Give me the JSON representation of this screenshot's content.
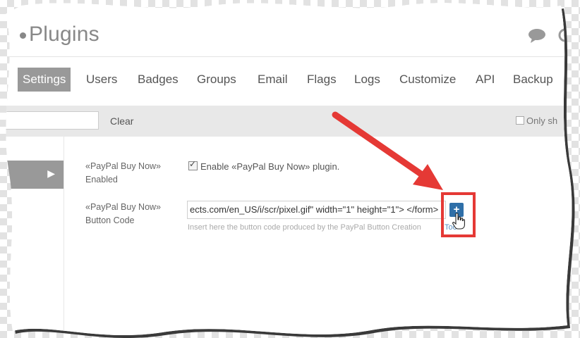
{
  "header": {
    "title": "Plugins",
    "icons": [
      "chat-icon",
      "search-icon"
    ]
  },
  "nav": {
    "tabs": [
      {
        "label": "Settings",
        "active": true
      },
      {
        "label": "Users"
      },
      {
        "label": "Badges"
      },
      {
        "label": "Groups"
      },
      {
        "label": "Email"
      },
      {
        "label": "Flags"
      },
      {
        "label": "Logs"
      },
      {
        "label": "Customize"
      },
      {
        "label": "API"
      },
      {
        "label": "Backup"
      }
    ]
  },
  "toolbar": {
    "filter_value": "",
    "clear_label": "Clear",
    "only_label": "Only sh"
  },
  "settings": {
    "enabled_label_1": "«PayPal Buy Now»",
    "enabled_label_2": "Enabled",
    "enable_text": "Enable «PayPal Buy Now» plugin.",
    "enable_checked": true,
    "code_label_1": "«PayPal Buy Now»",
    "code_label_2": "Button Code",
    "code_value": "ects.com/en_US/i/scr/pixel.gif\" width=\"1\" height=\"1\"> </form>",
    "help_text": "Insert here the button code produced by the PayPal Button Creation",
    "help_link": "Too"
  },
  "add_button": {
    "label": "+"
  },
  "colors": {
    "accent": "#2f6fa8",
    "active_tab": "#999999",
    "highlight": "#e53935"
  }
}
